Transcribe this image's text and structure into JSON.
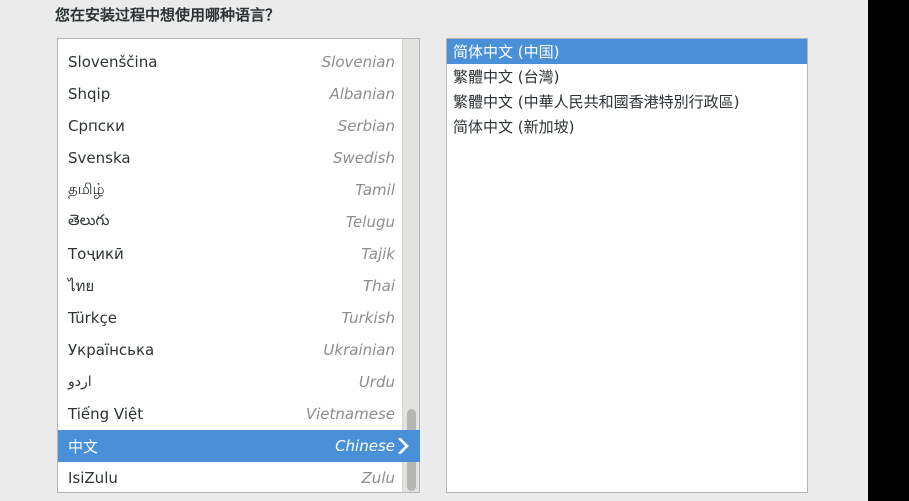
{
  "page": {
    "title": "您在安装过程中想使用哪种语言？",
    "background_color": "#ebebeb",
    "accent_color": "#4a90d9",
    "text_color": "#2e3436",
    "secondary_text_color": "#8d8d8d"
  },
  "language_list": {
    "scrollbar_position": "near-bottom",
    "items": [
      {
        "native": "Slovenščina",
        "english": "Slovenian",
        "selected": false,
        "rtl": false,
        "has_submenu": false
      },
      {
        "native": "Shqip",
        "english": "Albanian",
        "selected": false,
        "rtl": false,
        "has_submenu": false
      },
      {
        "native": "Српски",
        "english": "Serbian",
        "selected": false,
        "rtl": false,
        "has_submenu": false
      },
      {
        "native": "Svenska",
        "english": "Swedish",
        "selected": false,
        "rtl": false,
        "has_submenu": false
      },
      {
        "native": "தமிழ்",
        "english": "Tamil",
        "selected": false,
        "rtl": false,
        "has_submenu": false
      },
      {
        "native": "తెలుగు",
        "english": "Telugu",
        "selected": false,
        "rtl": false,
        "has_submenu": false
      },
      {
        "native": "Тоҷикӣ",
        "english": "Tajik",
        "selected": false,
        "rtl": false,
        "has_submenu": false
      },
      {
        "native": "ไทย",
        "english": "Thai",
        "selected": false,
        "rtl": false,
        "has_submenu": false
      },
      {
        "native": "Türkçe",
        "english": "Turkish",
        "selected": false,
        "rtl": false,
        "has_submenu": false
      },
      {
        "native": "Українська",
        "english": "Ukrainian",
        "selected": false,
        "rtl": false,
        "has_submenu": false
      },
      {
        "native": "اردو",
        "english": "Urdu",
        "selected": false,
        "rtl": true,
        "has_submenu": false
      },
      {
        "native": "Tiếng Việt",
        "english": "Vietnamese",
        "selected": false,
        "rtl": false,
        "has_submenu": false
      },
      {
        "native": "中文",
        "english": "Chinese",
        "selected": true,
        "rtl": false,
        "has_submenu": true
      },
      {
        "native": "IsiZulu",
        "english": "Zulu",
        "selected": false,
        "rtl": false,
        "has_submenu": false
      }
    ]
  },
  "variant_list": {
    "items": [
      {
        "label": "简体中文 (中国)",
        "selected": true
      },
      {
        "label": "繁體中文 (台灣)",
        "selected": false
      },
      {
        "label": "繁體中文 (中華人民共和國香港特別行政區)",
        "selected": false
      },
      {
        "label": "简体中文 (新加坡)",
        "selected": false
      }
    ]
  }
}
